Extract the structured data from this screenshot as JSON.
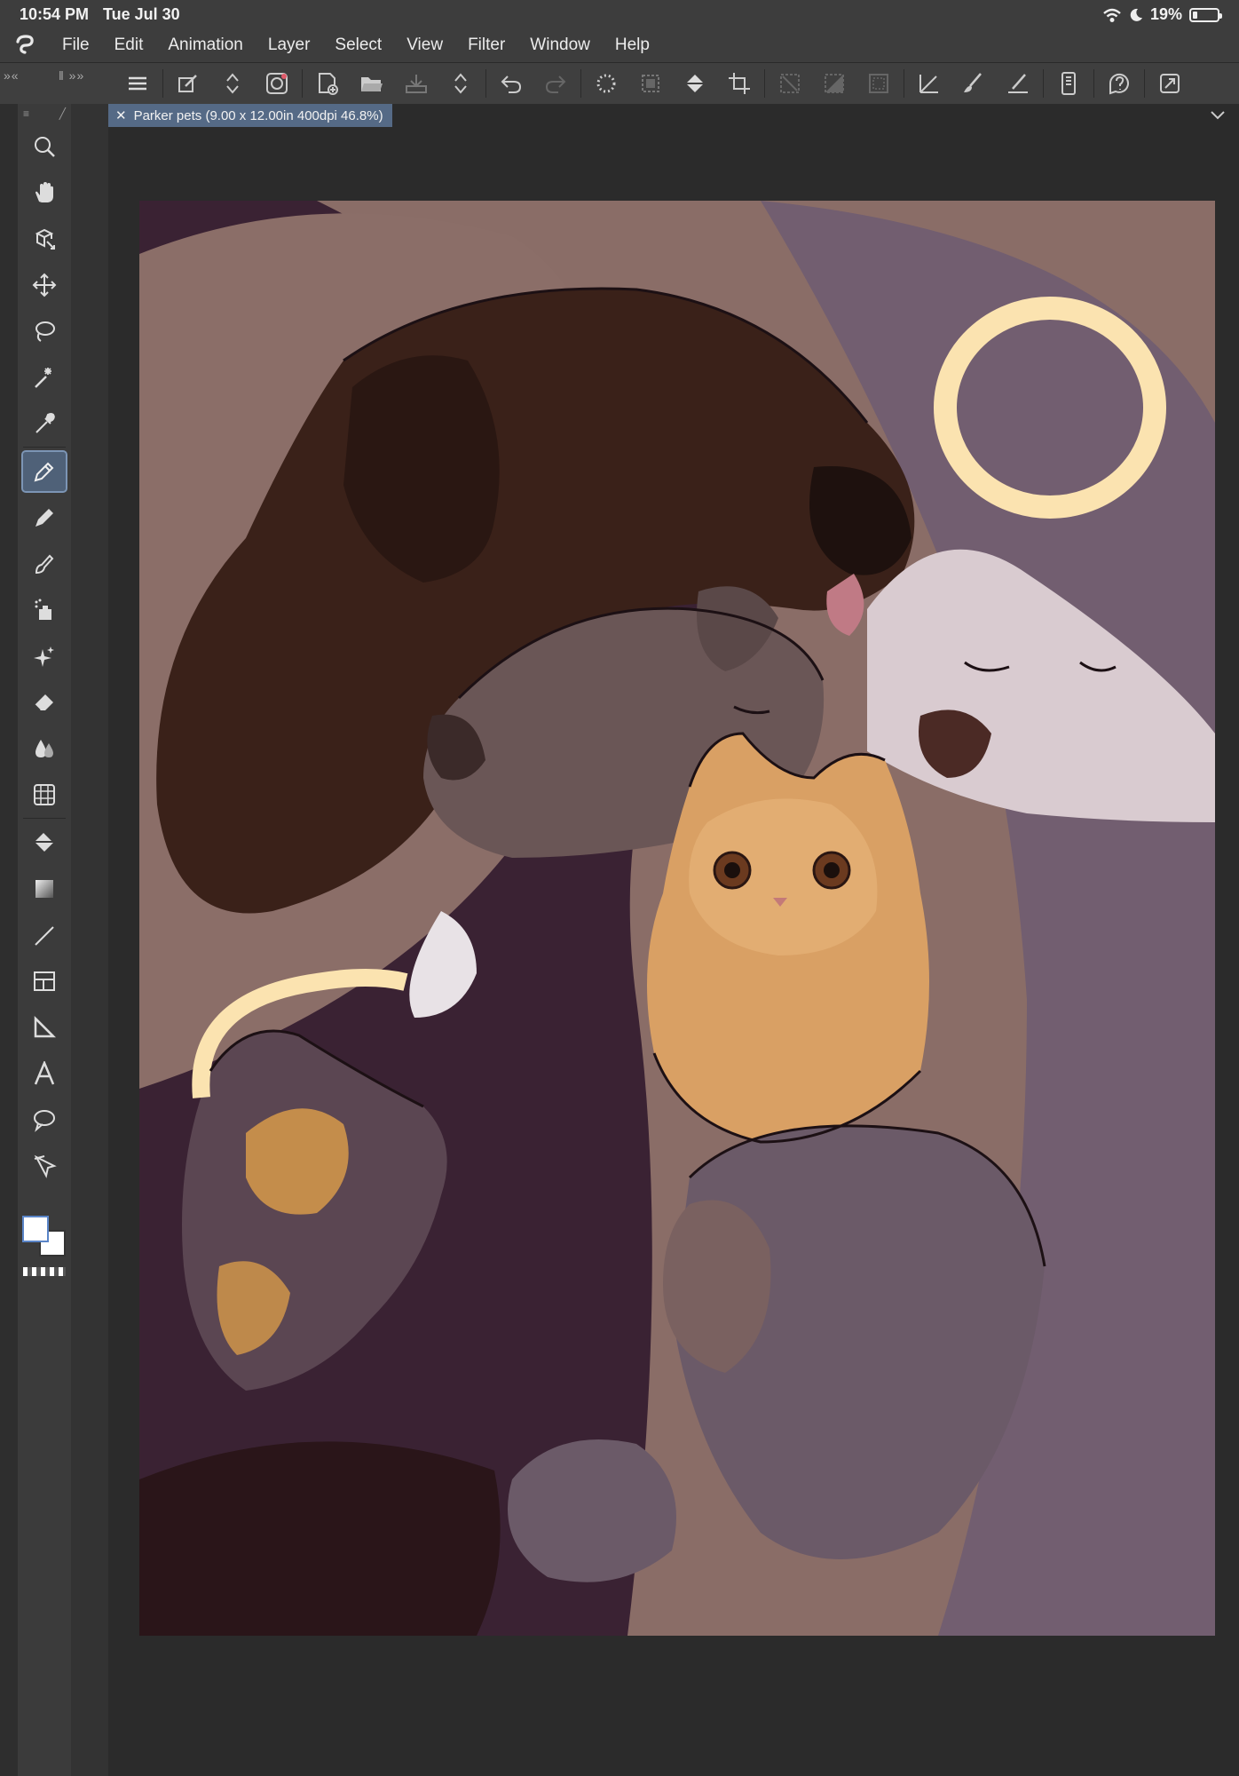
{
  "status_bar": {
    "time": "10:54 PM",
    "date": "Tue Jul 30",
    "battery": "19%",
    "battery_level": 0.19
  },
  "menu": {
    "items": [
      "File",
      "Edit",
      "Animation",
      "Layer",
      "Select",
      "View",
      "Filter",
      "Window",
      "Help"
    ]
  },
  "document": {
    "tab_title": "Parker pets (9.00 x 12.00in 400dpi 46.8%)"
  },
  "colors": {
    "ui_bg": "#2b2b2b",
    "panel": "#3b3b3b",
    "tab_active": "#556a86",
    "tool_active": "#4f6178",
    "main_color": "#ffffff",
    "sub_color": "#ffffff"
  },
  "toolbar_icons": [
    "menu-icon",
    "edit-wand-icon",
    "updown-arrows-icon",
    "spiral-icon",
    "new-canvas-icon",
    "open-folder-icon",
    "save-icon",
    "updown-arrows-icon",
    "undo-icon",
    "redo-icon",
    "marquee-icon",
    "selection-icon",
    "fill-icon",
    "crop-icon",
    "deselect-icon",
    "invert-icon",
    "border-icon",
    "ruler-icon",
    "brush-icon",
    "line-icon",
    "smartphone-icon",
    "help-icon",
    "fullscreen-icon"
  ],
  "tools": [
    "zoom-icon",
    "hand-icon",
    "rotate-icon",
    "move-icon",
    "lasso-icon",
    "magic-wand-icon",
    "eyedropper-icon",
    "pen-icon",
    "pencil-icon",
    "brush-icon",
    "airbrush-icon",
    "sparkle-icon",
    "eraser-icon",
    "blend-icon",
    "grid-icon",
    "fill-icon",
    "gradient-icon",
    "line-icon",
    "frame-icon",
    "ruler-icon",
    "text-icon",
    "balloon-icon",
    "correct-line-icon"
  ]
}
